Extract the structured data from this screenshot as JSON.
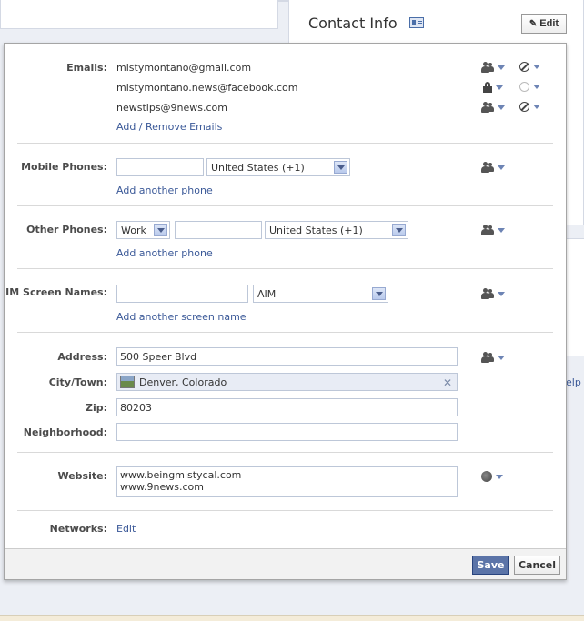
{
  "header": {
    "title": "Contact Info",
    "edit_label": "Edit",
    "help_link": "elp"
  },
  "emails": {
    "label": "Emails:",
    "items": [
      {
        "address": "mistymontano@gmail.com",
        "privacy": "people-icon",
        "visibility": "slashed-circle-icon"
      },
      {
        "address": "mistymontano.news@facebook.com",
        "privacy": "lock-icon",
        "visibility": "empty-circle-icon"
      },
      {
        "address": "newstips@9news.com",
        "privacy": "people-icon",
        "visibility": "slashed-circle-icon"
      }
    ],
    "add_link": "Add / Remove Emails"
  },
  "mobile_phones": {
    "label": "Mobile Phones:",
    "number_value": "",
    "country": "United States (+1)",
    "add_link": "Add another phone"
  },
  "other_phones": {
    "label": "Other Phones:",
    "type": "Work",
    "number_value": "",
    "country": "United States (+1)",
    "add_link": "Add another phone"
  },
  "im": {
    "label": "IM Screen Names:",
    "name_value": "",
    "service": "AIM",
    "add_link": "Add another screen name"
  },
  "address": {
    "address_label": "Address:",
    "address_value": "500 Speer Blvd",
    "city_label": "City/Town:",
    "city_value": "Denver, Colorado",
    "zip_label": "Zip:",
    "zip_value": "80203",
    "neighborhood_label": "Neighborhood:",
    "neighborhood_value": ""
  },
  "website": {
    "label": "Website:",
    "value": "www.beingmistycal.com\nwww.9news.com"
  },
  "networks": {
    "label": "Networks:",
    "edit_link": "Edit"
  },
  "footer": {
    "save_label": "Save",
    "cancel_label": "Cancel"
  },
  "colors": {
    "link": "#3b5998",
    "save_bg": "#5b74a8",
    "label": "#4b4b4b"
  }
}
